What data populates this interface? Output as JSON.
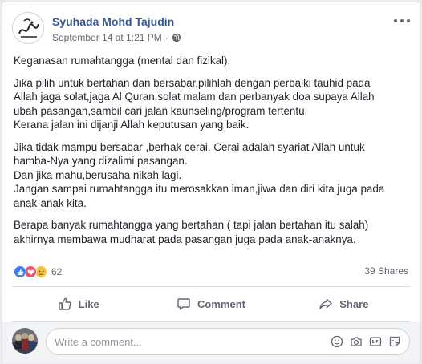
{
  "post": {
    "author": "Syuhada Mohd Tajudin",
    "date": "September 14 at 1:21 PM",
    "separator": "·",
    "paragraphs": [
      "Keganasan rumahtangga (mental dan fizikal).",
      "Jika pilih untuk bertahan dan bersabar,pilihlah dengan perbaiki tauhid pada\nAllah jaga solat,jaga Al Quran,solat malam dan perbanyak doa supaya Allah\nubah pasangan,sambil cari jalan kaunseling/program tertentu.\nKerana jalan ini dijanji Allah keputusan yang baik.",
      "Jika tidak mampu bersabar ,berhak cerai. Cerai adalah syariat Allah untuk\nhamba-Nya yang dizalimi pasangan.\nDan jika mahu,berusaha nikah lagi.\nJangan sampai rumahtangga itu merosakkan iman,jiwa dan diri kita juga pada\nanak-anak kita.",
      "Berapa banyak rumahtangga yang bertahan ( tapi jalan bertahan itu salah)\nakhirnya membawa mudharat pada pasangan juga pada anak-anaknya."
    ]
  },
  "stats": {
    "reaction_count": "62",
    "shares": "39 Shares",
    "reactions": [
      "like-icon",
      "love-icon",
      "sad-icon"
    ]
  },
  "actions": {
    "like": "Like",
    "comment": "Comment",
    "share": "Share"
  },
  "comment_box": {
    "placeholder": "Write a comment..."
  },
  "colors": {
    "author_link": "#365899",
    "like_blue": "#3b7cff",
    "love_red": "#f0516c",
    "sad_yellow": "#f7c23c",
    "muted": "#606770"
  }
}
